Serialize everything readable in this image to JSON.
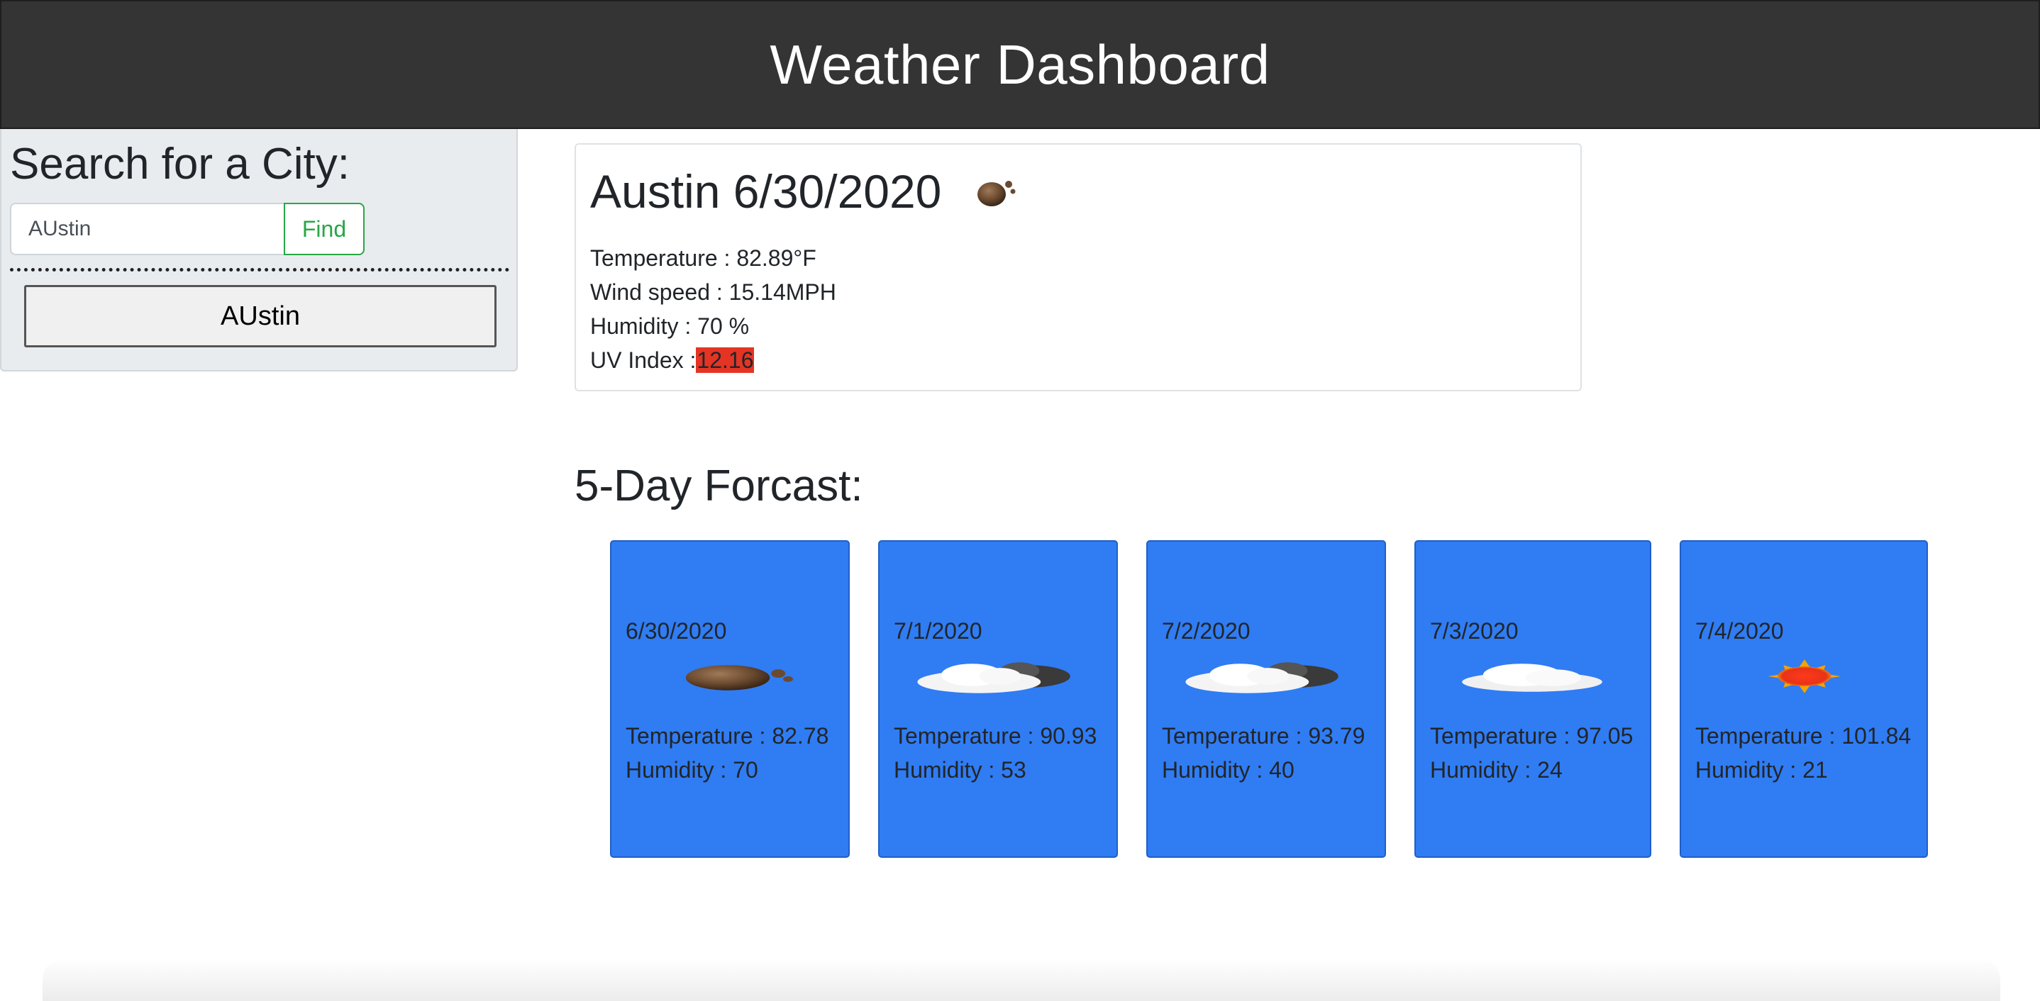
{
  "header": {
    "title": "Weather Dashboard"
  },
  "search": {
    "heading": "Search for a City:",
    "input_value": "AUstin",
    "find_label": "Find",
    "history": [
      "AUstin"
    ]
  },
  "current": {
    "title": "Austin 6/30/2020",
    "icon": "drizzle-icon",
    "temperature": "Temperature : 82.89°F",
    "wind": "Wind speed : 15.14MPH",
    "humidity": "Humidity : 70 %",
    "uv_label": "UV Index :",
    "uv_value": "12.16",
    "uv_color": "#e53424"
  },
  "forecast": {
    "heading": "5-Day Forcast:",
    "card_color": "#307cf3",
    "days": [
      {
        "date": "6/30/2020",
        "icon": "drizzle-icon",
        "temp": "Temperature : 82.78",
        "humidity": "Humidity : 70"
      },
      {
        "date": "7/1/2020",
        "icon": "broken-clouds-icon",
        "temp": "Temperature : 90.93",
        "humidity": "Humidity : 53"
      },
      {
        "date": "7/2/2020",
        "icon": "broken-clouds-icon",
        "temp": "Temperature : 93.79",
        "humidity": "Humidity : 40"
      },
      {
        "date": "7/3/2020",
        "icon": "cloud-icon",
        "temp": "Temperature : 97.05",
        "humidity": "Humidity : 24"
      },
      {
        "date": "7/4/2020",
        "icon": "sun-icon",
        "temp": "Temperature : 101.84",
        "humidity": "Humidity : 21"
      }
    ]
  }
}
